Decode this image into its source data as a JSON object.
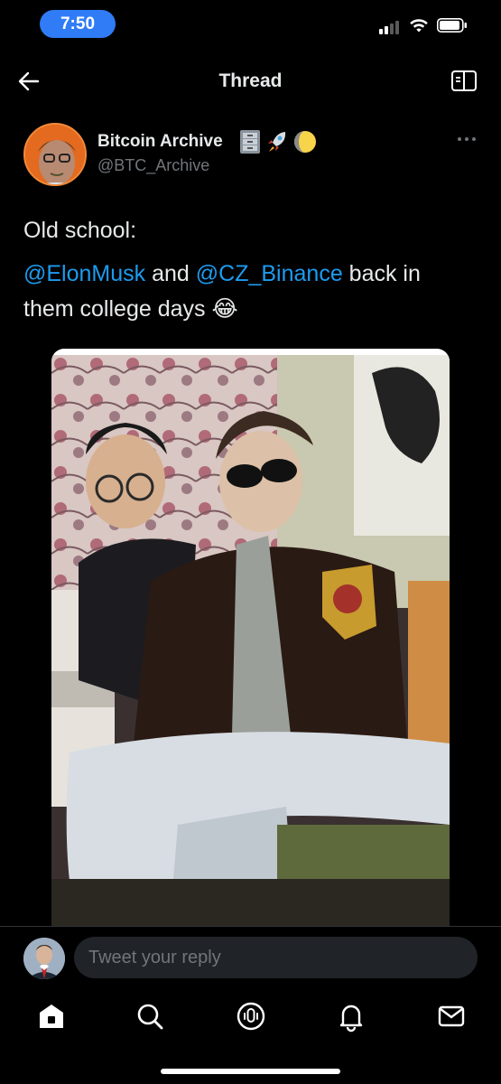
{
  "status_bar": {
    "time": "7:50",
    "signal_bars_filled": 2,
    "battery_level": 0.85
  },
  "nav": {
    "title": "Thread",
    "back_icon": "arrow-left-icon",
    "reader_icon": "reader-mode-icon"
  },
  "tweet": {
    "author_name": "Bitcoin Archive",
    "name_badges": [
      "🗄️",
      "🚀",
      "🌔"
    ],
    "author_handle": "@BTC_Archive",
    "text_line1": "Old school:",
    "mention1": "@ElonMusk",
    "connector": " and ",
    "mention2": "@CZ_Binance",
    "rest": " back in them college days ",
    "emoji": "😂",
    "more_icon": "more-horizontal-icon"
  },
  "reply_bar": {
    "placeholder": "Tweet your reply"
  },
  "tab_bar": {
    "tabs": [
      "home-icon",
      "search-icon",
      "spaces-icon",
      "notifications-icon",
      "messages-icon"
    ]
  },
  "colors": {
    "accent": "#1d9bf0",
    "text": "#e7e9ea",
    "muted": "#71767b",
    "time_pill": "#2f7cf6"
  }
}
